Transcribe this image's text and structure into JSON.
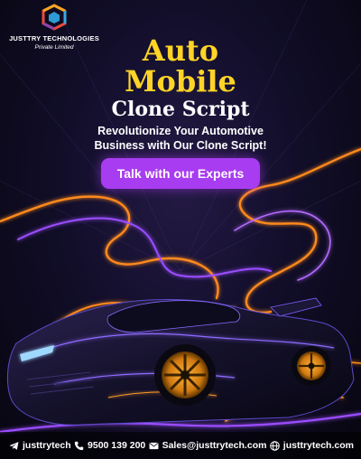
{
  "brand": {
    "name": "JUSTTRY TECHNOLOGIES",
    "subtitle": "Private Limited"
  },
  "headline": {
    "line1": "Auto",
    "line2": "Mobile",
    "line3": "Clone Script"
  },
  "tagline": {
    "line1": "Revolutionize Your Automotive",
    "line2": "Business with Our Clone Script!"
  },
  "cta": {
    "label": "Talk with our Experts"
  },
  "footer": {
    "telegram": "justtrytech",
    "phone": "9500 139 200",
    "email": "Sales@justtrytech.com",
    "website": "justtrytech.com"
  },
  "colors": {
    "headline": "#ffd426",
    "cta_background": "#a83cf0",
    "neon_orange": "#ff8a1f",
    "neon_purple": "#9b4dff"
  },
  "icons": [
    "logo-hexagon-icon",
    "telegram-icon",
    "phone-icon",
    "mail-icon",
    "globe-icon"
  ]
}
